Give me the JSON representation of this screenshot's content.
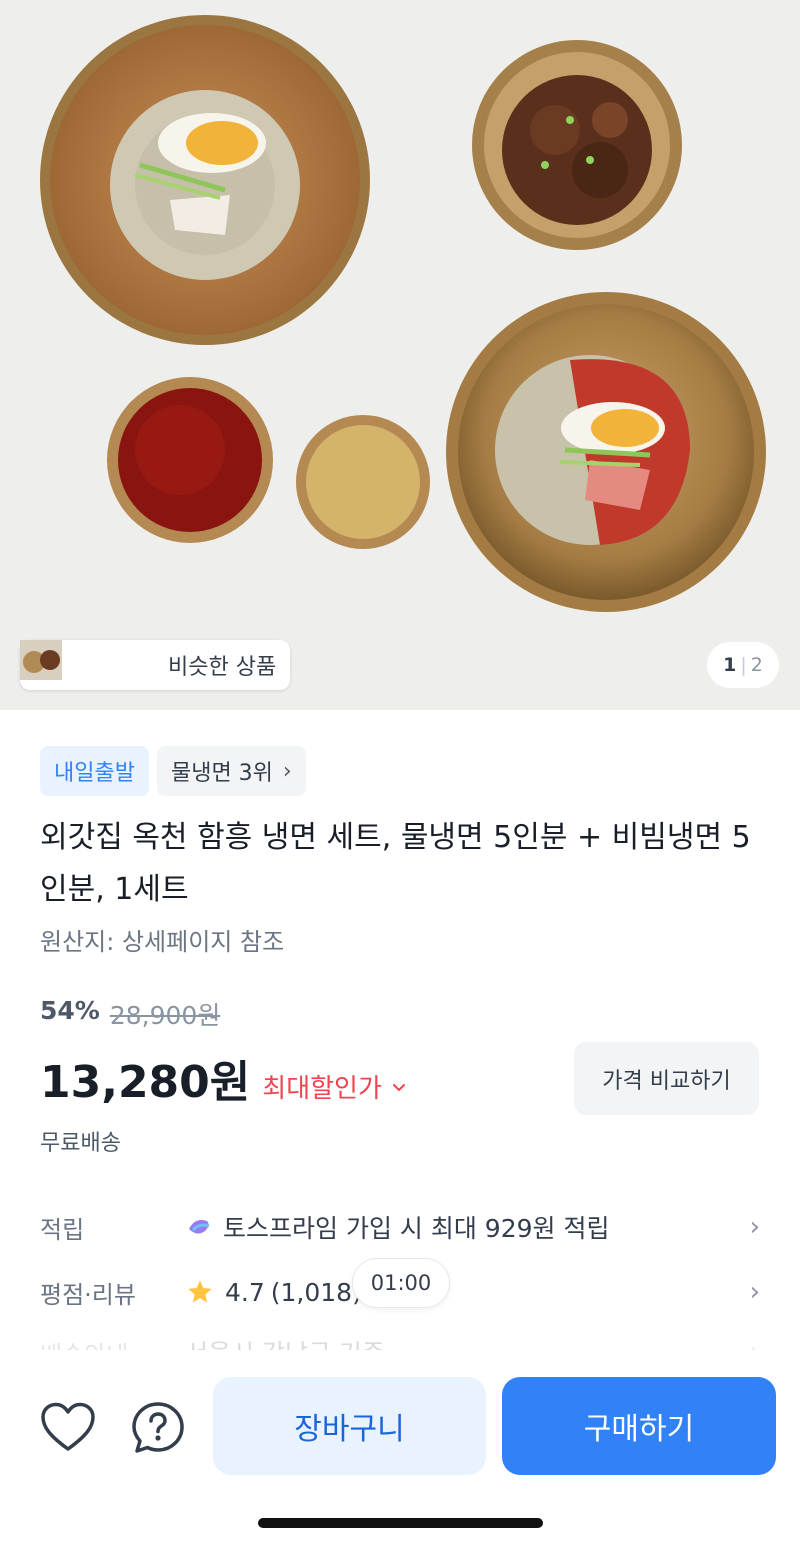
{
  "gallery": {
    "similar_label": "비슷한 상품",
    "page_current": "1",
    "page_total": "2"
  },
  "badges": {
    "delivery": "내일출발",
    "rank": "물냉면 3위"
  },
  "product": {
    "title": "외갓집 옥천 함흥 냉면 세트, 물냉면 5인분 + 비빔냉면 5인분, 1세트",
    "origin": "원산지: 상세페이지 참조",
    "discount_rate": "54%",
    "original_price": "28,900원",
    "price": "13,280원",
    "max_discount_label": "최대할인가",
    "compare_label": "가격 비교하기",
    "shipping": "무료배송"
  },
  "rows": {
    "points_label": "적립",
    "points_value": "토스프라임 가입 시 최대 929원 적립",
    "rating_label": "평점·리뷰",
    "rating_value": "4.7",
    "review_count": "(1,018)",
    "delivery_label": "배송안내",
    "delivery_value": "서울시 강남구 기준"
  },
  "timer": "01:00",
  "bottom": {
    "cart_label": "장바구니",
    "buy_label": "구매하기"
  },
  "colors": {
    "accent": "#3182f6",
    "accent_light": "#e8f3ff",
    "discount_red": "#f04452",
    "star": "#ffc342"
  },
  "icons": [
    "heart-icon",
    "question-chat-icon",
    "chevron-right-icon",
    "chevron-down-icon",
    "star-icon",
    "toss-prime-icon"
  ]
}
